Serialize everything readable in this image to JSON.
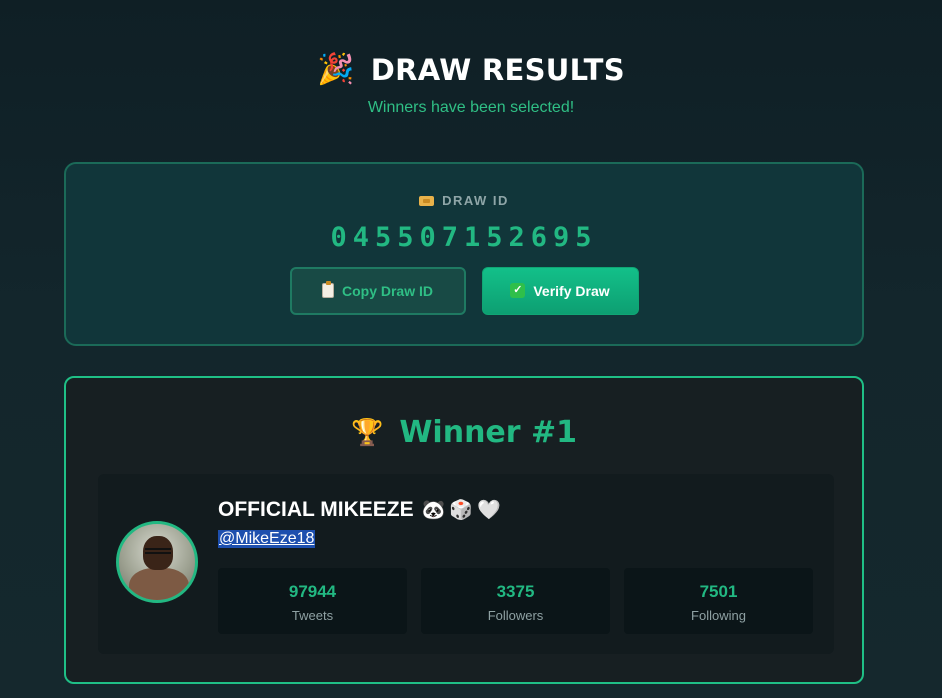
{
  "header": {
    "title_emoji": "🎉",
    "title": "DRAW RESULTS",
    "subtitle": "Winners have been selected!"
  },
  "draw": {
    "label": "DRAW ID",
    "id": "045507152695",
    "copy_button_label": "Copy Draw ID",
    "verify_button_label": "Verify Draw"
  },
  "winner": {
    "title": "Winner #1",
    "name": "OFFICIAL MIKEEZE",
    "name_emojis": "🐼🎲🤍",
    "handle": "@MikeEze18",
    "stats": [
      {
        "value": "97944",
        "label": "Tweets"
      },
      {
        "value": "3375",
        "label": "Followers"
      },
      {
        "value": "7501",
        "label": "Following"
      }
    ]
  },
  "colors": {
    "accent": "#22b882",
    "background": "#13262c",
    "card_border": "#1fbf86"
  },
  "icons": {
    "title": "party-popper-icon",
    "draw_label": "ticket-icon",
    "copy": "clipboard-icon",
    "verify": "check-icon",
    "winner": "trophy-icon"
  }
}
